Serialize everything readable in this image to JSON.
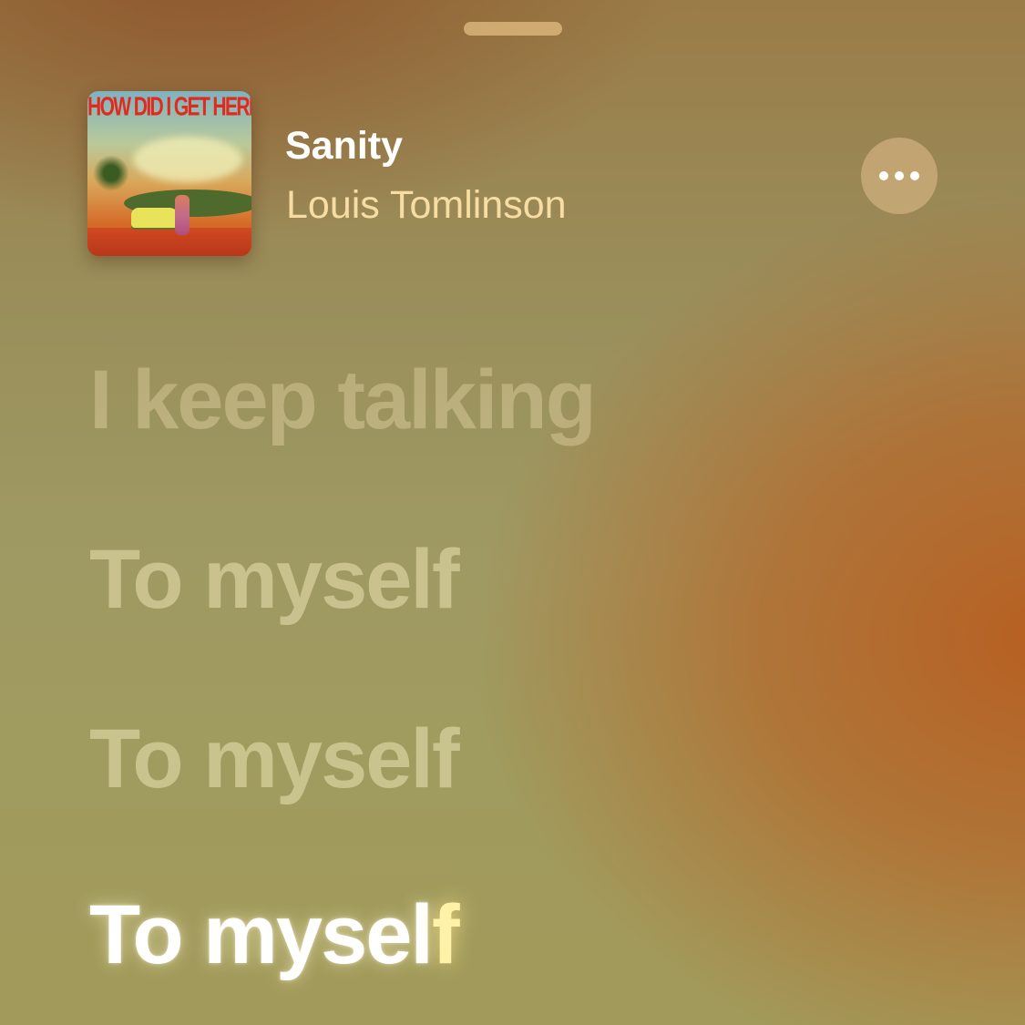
{
  "sheet": {
    "grabber_icon": "drag-handle"
  },
  "now_playing": {
    "artwork_text": "HOW DID I GET HERE?",
    "title": "Sanity",
    "artist": "Louis Tomlinson",
    "more_icon": "ellipsis-icon"
  },
  "lyrics": {
    "lines": [
      "I keep talking",
      "To myself",
      "To myself"
    ],
    "current": {
      "highlighted": "To mysel",
      "upcoming": "f"
    }
  },
  "colors": {
    "accent_orange": "#b95c1e",
    "background_olive": "#a09b5e",
    "current_lyric": "#ffffff"
  }
}
